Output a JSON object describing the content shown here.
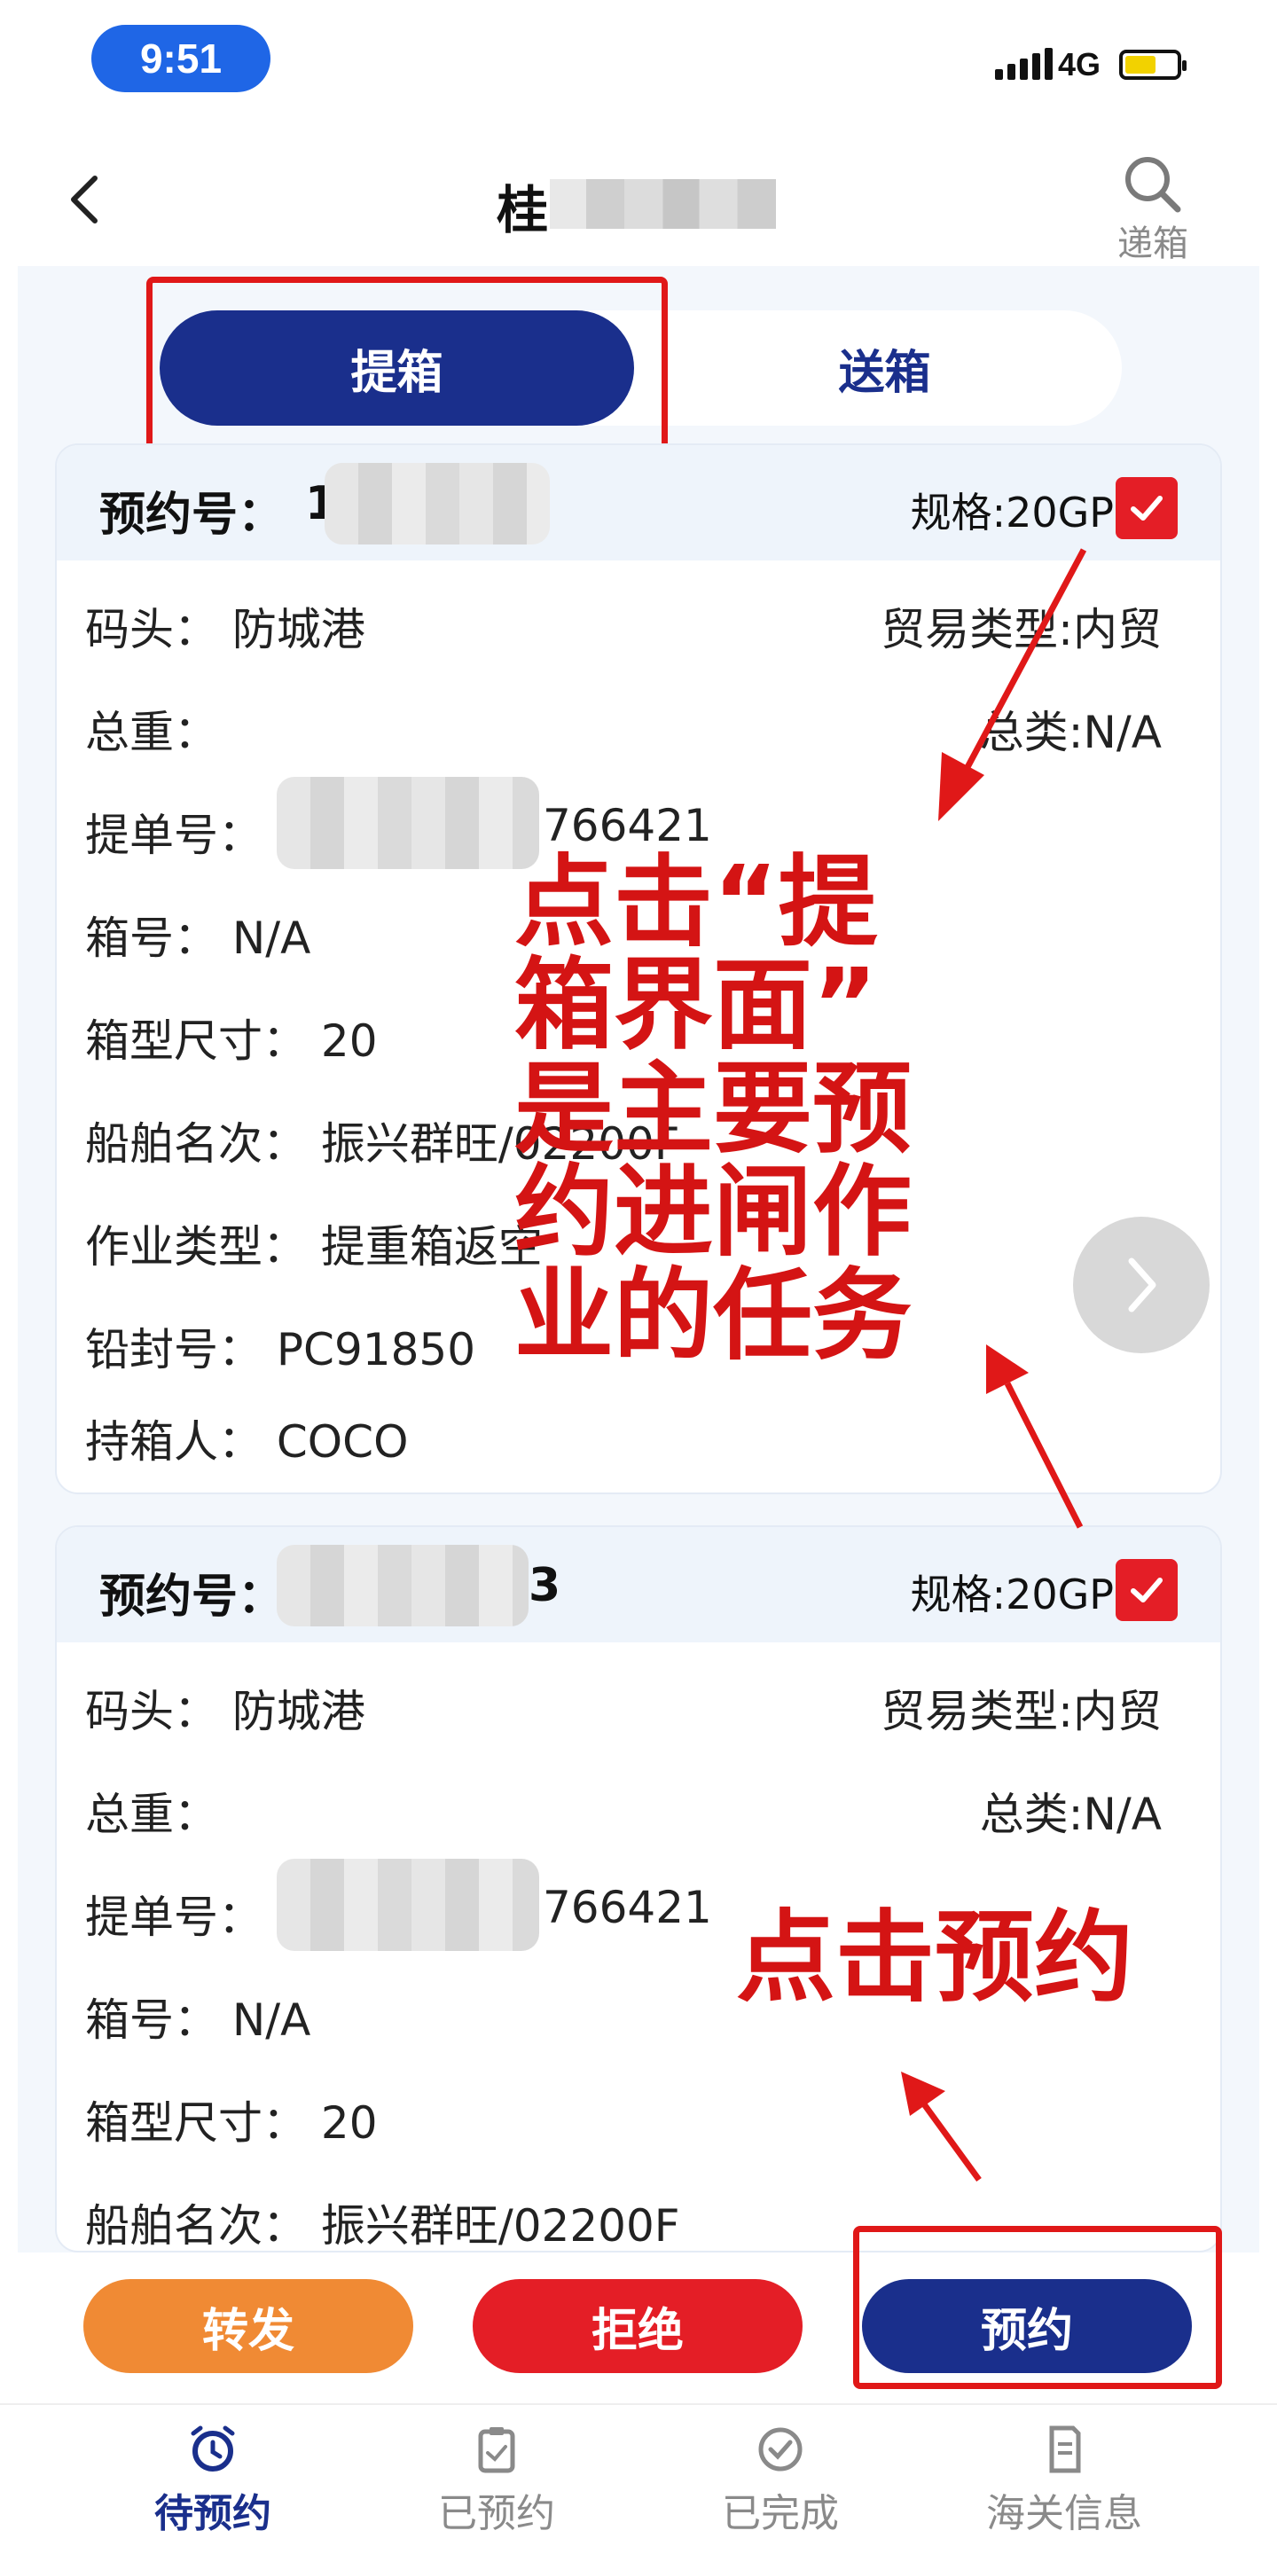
{
  "status_bar": {
    "time": "9:51",
    "network": "4G"
  },
  "header": {
    "title_visible": "桂",
    "search_label": "递箱"
  },
  "tabs": [
    {
      "label": "提箱",
      "active": true
    },
    {
      "label": "送箱",
      "active": false
    }
  ],
  "cards": [
    {
      "appointment_label": "预约号：",
      "appointment_visible": "1",
      "spec": "规格:20GP",
      "checked": true,
      "terminal": "码头：  防城港",
      "trade_type": "贸易类型:内贸",
      "gross_weight": "总重：",
      "category": "总类:N/A",
      "bill_label": "提单号：",
      "bill_tail": "766421",
      "container_no": "箱号：  N/A",
      "container_size": "箱型尺寸：  20",
      "vessel": "船舶名次：  振兴群旺/02200F",
      "work_type": "作业类型：  提重箱返空",
      "seal_no": "铅封号：      PC91850",
      "holder": "持箱人：      COCO"
    },
    {
      "appointment_label": "预约号：",
      "appointment_visible": "3",
      "spec": "规格:20GP",
      "checked": true,
      "terminal": "码头：  防城港",
      "trade_type": "贸易类型:内贸",
      "gross_weight": "总重：",
      "category": "总类:N/A",
      "bill_label": "提单号：",
      "bill_tail": "766421",
      "container_no": "箱号：  N/A",
      "container_size": "箱型尺寸：  20",
      "vessel": "船舶名次：  振兴群旺/02200F"
    }
  ],
  "annotations": {
    "a1_line1": "点击“提",
    "a1_line2": "箱界面”",
    "a1_line3": "是主要预",
    "a1_line4": "约进闸作",
    "a1_line5": "业的任务",
    "a2": "点击预约"
  },
  "actions": {
    "forward": "转发",
    "reject": "拒绝",
    "book": "预约",
    "forward_color": "#f08a34",
    "reject_color": "#e41e26",
    "book_color": "#1a2f8c"
  },
  "tab_bar": [
    {
      "label": "待预约",
      "icon": "alarm-clock-icon",
      "active": true
    },
    {
      "label": "已预约",
      "icon": "clipboard-icon",
      "active": false
    },
    {
      "label": "已完成",
      "icon": "check-circle-icon",
      "active": false
    },
    {
      "label": "海关信息",
      "icon": "document-icon",
      "active": false
    }
  ],
  "colors": {
    "primary": "#1a2f8c",
    "annotation": "#d41414",
    "status_pill": "#1f66e6"
  }
}
